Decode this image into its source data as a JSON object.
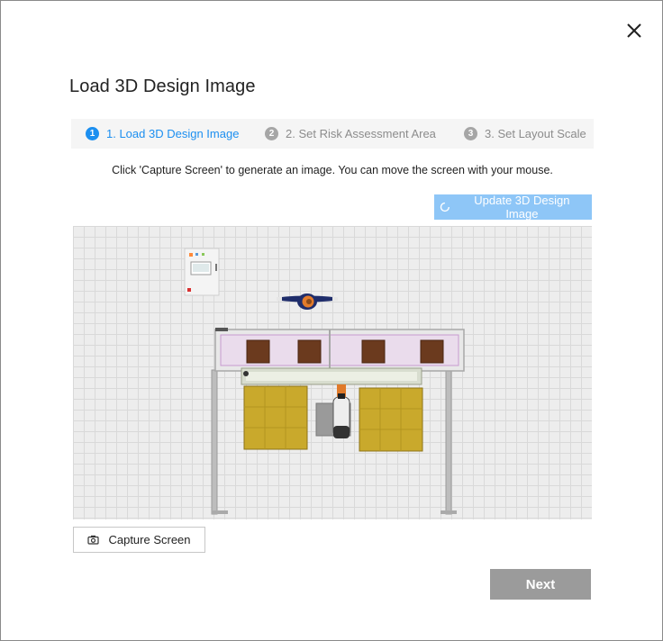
{
  "dialog": {
    "title": "Load 3D Design Image",
    "close_icon": "close-icon"
  },
  "steps": [
    {
      "number": "1",
      "label": "1. Load 3D Design Image",
      "active": true
    },
    {
      "number": "2",
      "label": "2. Set Risk Assessment Area",
      "active": false
    },
    {
      "number": "3",
      "label": "3. Set Layout Scale",
      "active": false
    }
  ],
  "instruction": "Click 'Capture Screen' to generate an image. You can move the screen with your mouse.",
  "update_button": {
    "label": "Update 3D Design Image",
    "icon": "refresh-icon"
  },
  "capture_button": {
    "label": "Capture Screen",
    "icon": "camera-icon"
  },
  "next_button": {
    "label": "Next"
  },
  "colors": {
    "accent": "#1c8ff0",
    "update_button_bg": "#8ec6f7",
    "next_button_bg": "#9b9b9b",
    "step_bar_bg": "#f5f5f5",
    "grid_bg": "#ededed"
  }
}
